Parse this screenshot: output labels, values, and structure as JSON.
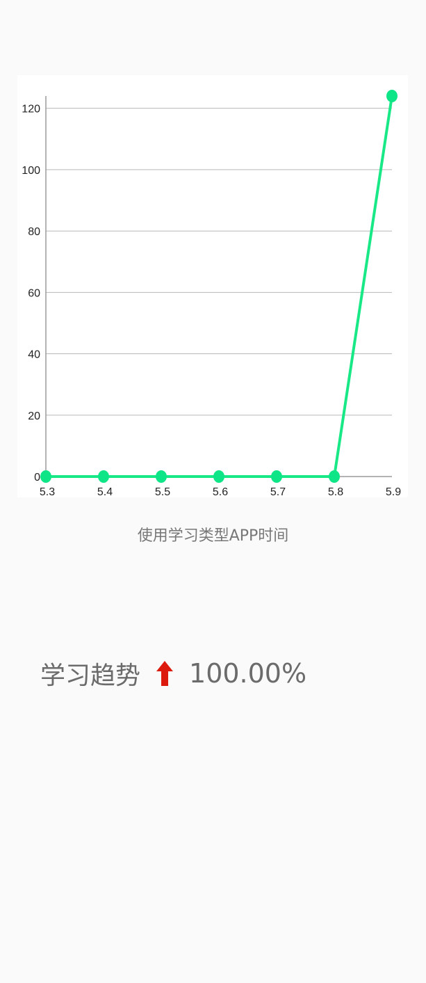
{
  "chart_data": {
    "type": "line",
    "x": [
      "5.3",
      "5.4",
      "5.5",
      "5.6",
      "5.7",
      "5.8",
      "5.9"
    ],
    "series": [
      {
        "values": [
          0,
          0,
          0,
          0,
          0,
          0,
          124
        ]
      }
    ],
    "ylim": [
      0,
      124
    ],
    "yticks": [
      0,
      20,
      40,
      60,
      80,
      100,
      120
    ],
    "grid": true,
    "line_color": "#19e887",
    "marker_color": "#0ee586"
  },
  "caption": "使用学习类型APP时间",
  "trend": {
    "label": "学习趋势",
    "value": "100.00%",
    "arrow_icon": "up-arrow-icon",
    "arrow_color": "#dd1a0e"
  }
}
